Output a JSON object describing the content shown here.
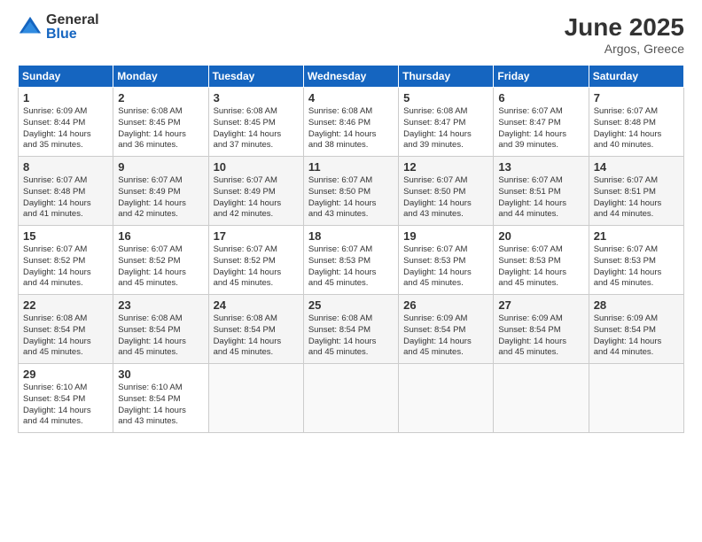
{
  "header": {
    "logo_general": "General",
    "logo_blue": "Blue",
    "month_title": "June 2025",
    "subtitle": "Argos, Greece"
  },
  "days_of_week": [
    "Sunday",
    "Monday",
    "Tuesday",
    "Wednesday",
    "Thursday",
    "Friday",
    "Saturday"
  ],
  "weeks": [
    [
      {
        "day": "1",
        "info": "Sunrise: 6:09 AM\nSunset: 8:44 PM\nDaylight: 14 hours\nand 35 minutes."
      },
      {
        "day": "2",
        "info": "Sunrise: 6:08 AM\nSunset: 8:45 PM\nDaylight: 14 hours\nand 36 minutes."
      },
      {
        "day": "3",
        "info": "Sunrise: 6:08 AM\nSunset: 8:45 PM\nDaylight: 14 hours\nand 37 minutes."
      },
      {
        "day": "4",
        "info": "Sunrise: 6:08 AM\nSunset: 8:46 PM\nDaylight: 14 hours\nand 38 minutes."
      },
      {
        "day": "5",
        "info": "Sunrise: 6:08 AM\nSunset: 8:47 PM\nDaylight: 14 hours\nand 39 minutes."
      },
      {
        "day": "6",
        "info": "Sunrise: 6:07 AM\nSunset: 8:47 PM\nDaylight: 14 hours\nand 39 minutes."
      },
      {
        "day": "7",
        "info": "Sunrise: 6:07 AM\nSunset: 8:48 PM\nDaylight: 14 hours\nand 40 minutes."
      }
    ],
    [
      {
        "day": "8",
        "info": "Sunrise: 6:07 AM\nSunset: 8:48 PM\nDaylight: 14 hours\nand 41 minutes."
      },
      {
        "day": "9",
        "info": "Sunrise: 6:07 AM\nSunset: 8:49 PM\nDaylight: 14 hours\nand 42 minutes."
      },
      {
        "day": "10",
        "info": "Sunrise: 6:07 AM\nSunset: 8:49 PM\nDaylight: 14 hours\nand 42 minutes."
      },
      {
        "day": "11",
        "info": "Sunrise: 6:07 AM\nSunset: 8:50 PM\nDaylight: 14 hours\nand 43 minutes."
      },
      {
        "day": "12",
        "info": "Sunrise: 6:07 AM\nSunset: 8:50 PM\nDaylight: 14 hours\nand 43 minutes."
      },
      {
        "day": "13",
        "info": "Sunrise: 6:07 AM\nSunset: 8:51 PM\nDaylight: 14 hours\nand 44 minutes."
      },
      {
        "day": "14",
        "info": "Sunrise: 6:07 AM\nSunset: 8:51 PM\nDaylight: 14 hours\nand 44 minutes."
      }
    ],
    [
      {
        "day": "15",
        "info": "Sunrise: 6:07 AM\nSunset: 8:52 PM\nDaylight: 14 hours\nand 44 minutes."
      },
      {
        "day": "16",
        "info": "Sunrise: 6:07 AM\nSunset: 8:52 PM\nDaylight: 14 hours\nand 45 minutes."
      },
      {
        "day": "17",
        "info": "Sunrise: 6:07 AM\nSunset: 8:52 PM\nDaylight: 14 hours\nand 45 minutes."
      },
      {
        "day": "18",
        "info": "Sunrise: 6:07 AM\nSunset: 8:53 PM\nDaylight: 14 hours\nand 45 minutes."
      },
      {
        "day": "19",
        "info": "Sunrise: 6:07 AM\nSunset: 8:53 PM\nDaylight: 14 hours\nand 45 minutes."
      },
      {
        "day": "20",
        "info": "Sunrise: 6:07 AM\nSunset: 8:53 PM\nDaylight: 14 hours\nand 45 minutes."
      },
      {
        "day": "21",
        "info": "Sunrise: 6:07 AM\nSunset: 8:53 PM\nDaylight: 14 hours\nand 45 minutes."
      }
    ],
    [
      {
        "day": "22",
        "info": "Sunrise: 6:08 AM\nSunset: 8:54 PM\nDaylight: 14 hours\nand 45 minutes."
      },
      {
        "day": "23",
        "info": "Sunrise: 6:08 AM\nSunset: 8:54 PM\nDaylight: 14 hours\nand 45 minutes."
      },
      {
        "day": "24",
        "info": "Sunrise: 6:08 AM\nSunset: 8:54 PM\nDaylight: 14 hours\nand 45 minutes."
      },
      {
        "day": "25",
        "info": "Sunrise: 6:08 AM\nSunset: 8:54 PM\nDaylight: 14 hours\nand 45 minutes."
      },
      {
        "day": "26",
        "info": "Sunrise: 6:09 AM\nSunset: 8:54 PM\nDaylight: 14 hours\nand 45 minutes."
      },
      {
        "day": "27",
        "info": "Sunrise: 6:09 AM\nSunset: 8:54 PM\nDaylight: 14 hours\nand 45 minutes."
      },
      {
        "day": "28",
        "info": "Sunrise: 6:09 AM\nSunset: 8:54 PM\nDaylight: 14 hours\nand 44 minutes."
      }
    ],
    [
      {
        "day": "29",
        "info": "Sunrise: 6:10 AM\nSunset: 8:54 PM\nDaylight: 14 hours\nand 44 minutes."
      },
      {
        "day": "30",
        "info": "Sunrise: 6:10 AM\nSunset: 8:54 PM\nDaylight: 14 hours\nand 43 minutes."
      },
      {
        "day": "",
        "info": ""
      },
      {
        "day": "",
        "info": ""
      },
      {
        "day": "",
        "info": ""
      },
      {
        "day": "",
        "info": ""
      },
      {
        "day": "",
        "info": ""
      }
    ]
  ]
}
